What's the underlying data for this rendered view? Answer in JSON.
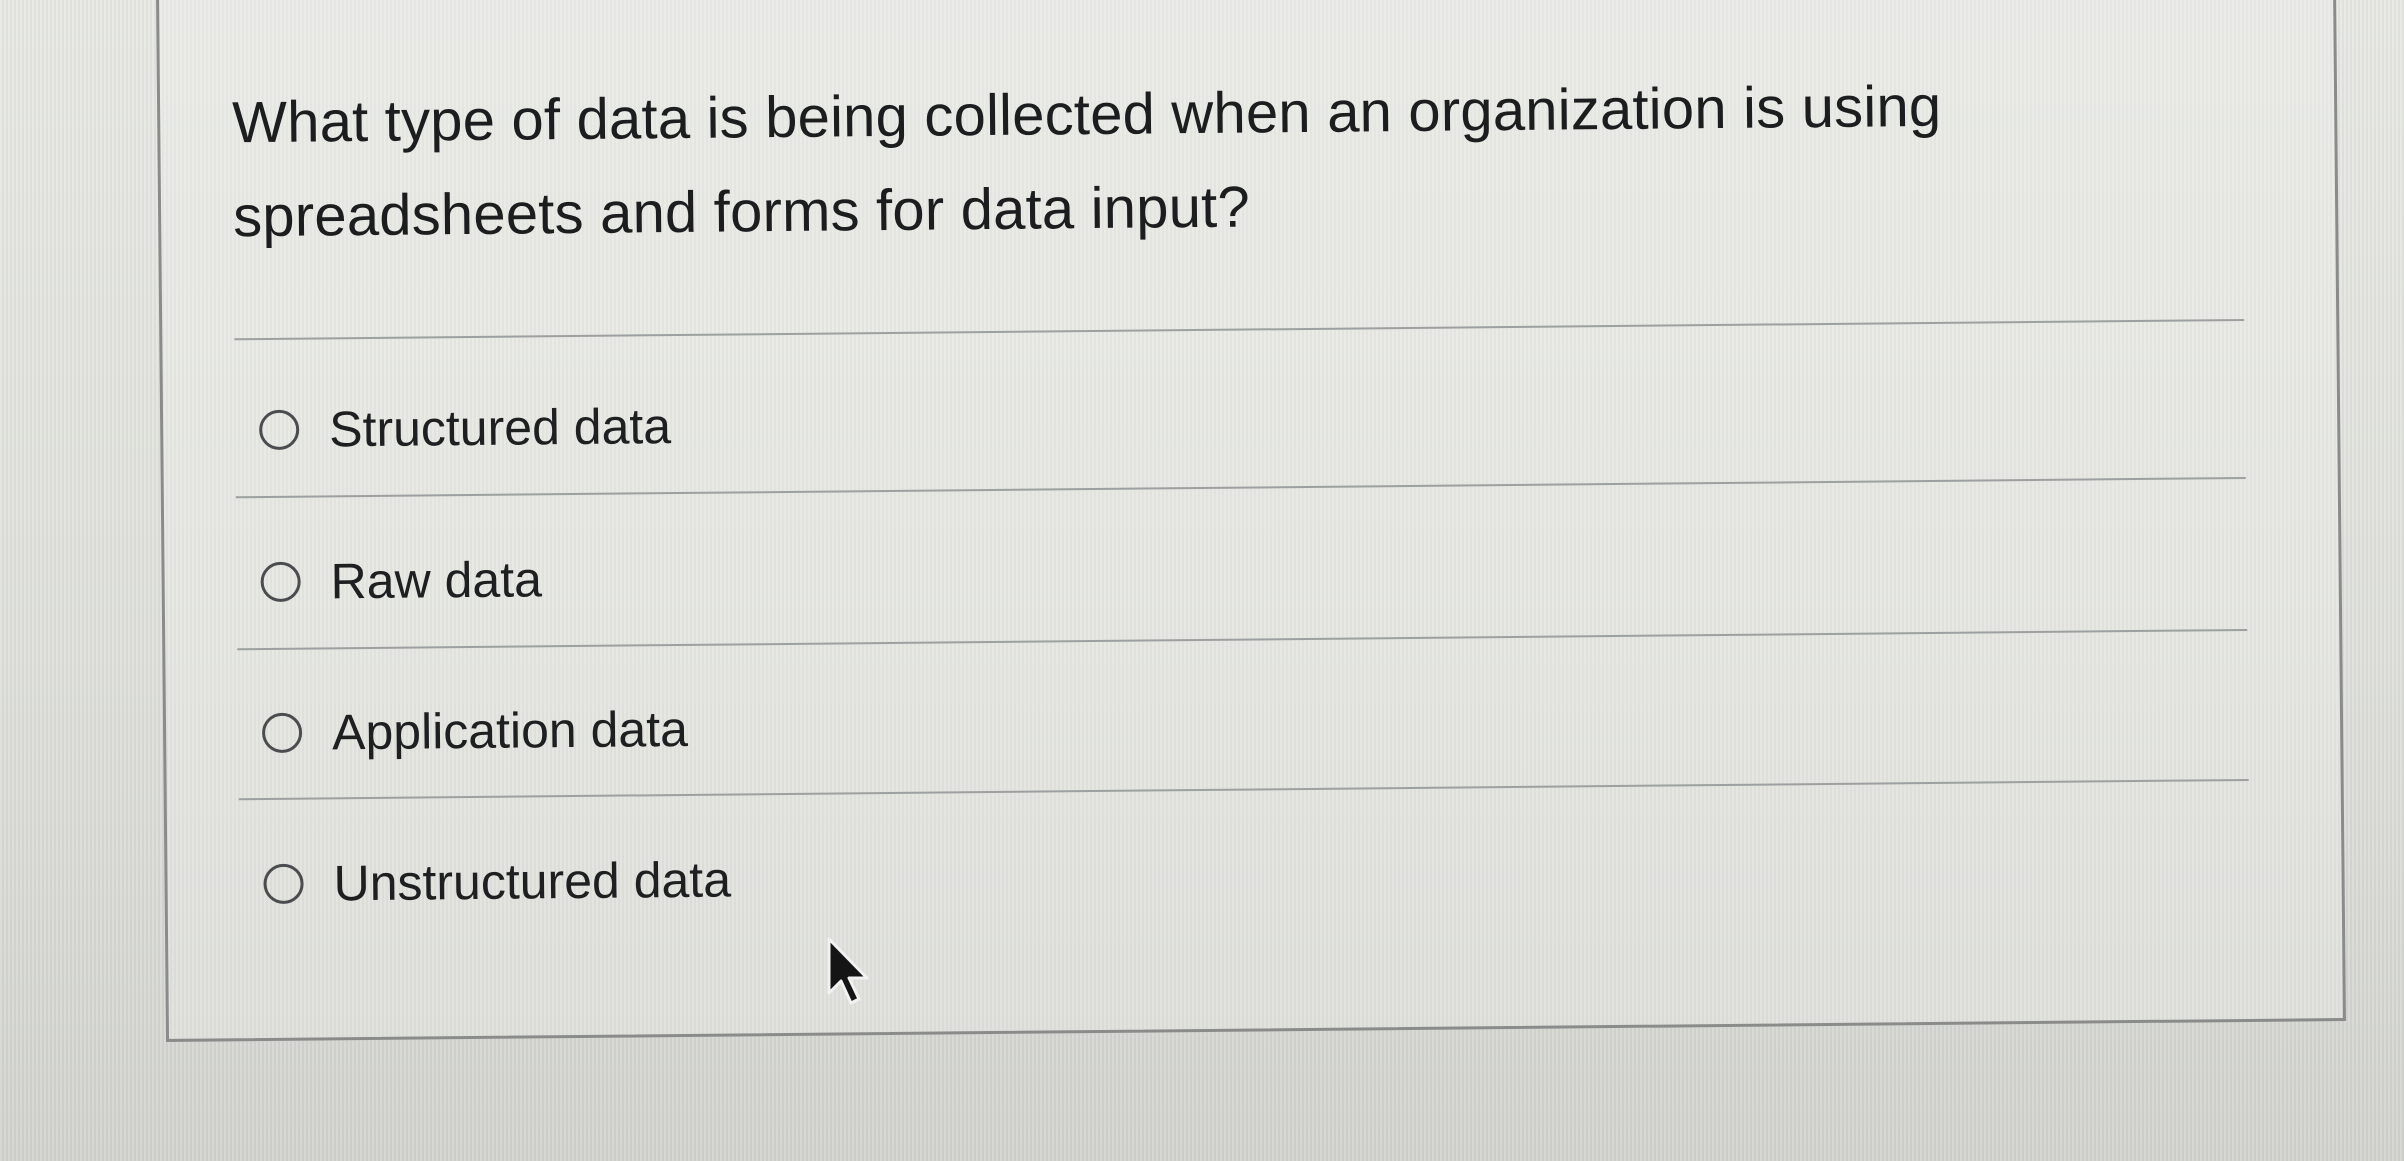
{
  "question": {
    "text": "What type of data is being collected when an organization is using spreadsheets and forms for data input?"
  },
  "options": [
    {
      "label": "Structured data",
      "selected": false
    },
    {
      "label": "Raw data",
      "selected": false
    },
    {
      "label": "Application data",
      "selected": false
    },
    {
      "label": "Unstructured data",
      "selected": false
    }
  ],
  "icons": {
    "radio": "radio-button-empty-icon",
    "cursor": "mouse-pointer-icon"
  },
  "colors": {
    "text": "#1c1d1f",
    "border": "#8a8c8c",
    "divider": "#9da0a0"
  }
}
